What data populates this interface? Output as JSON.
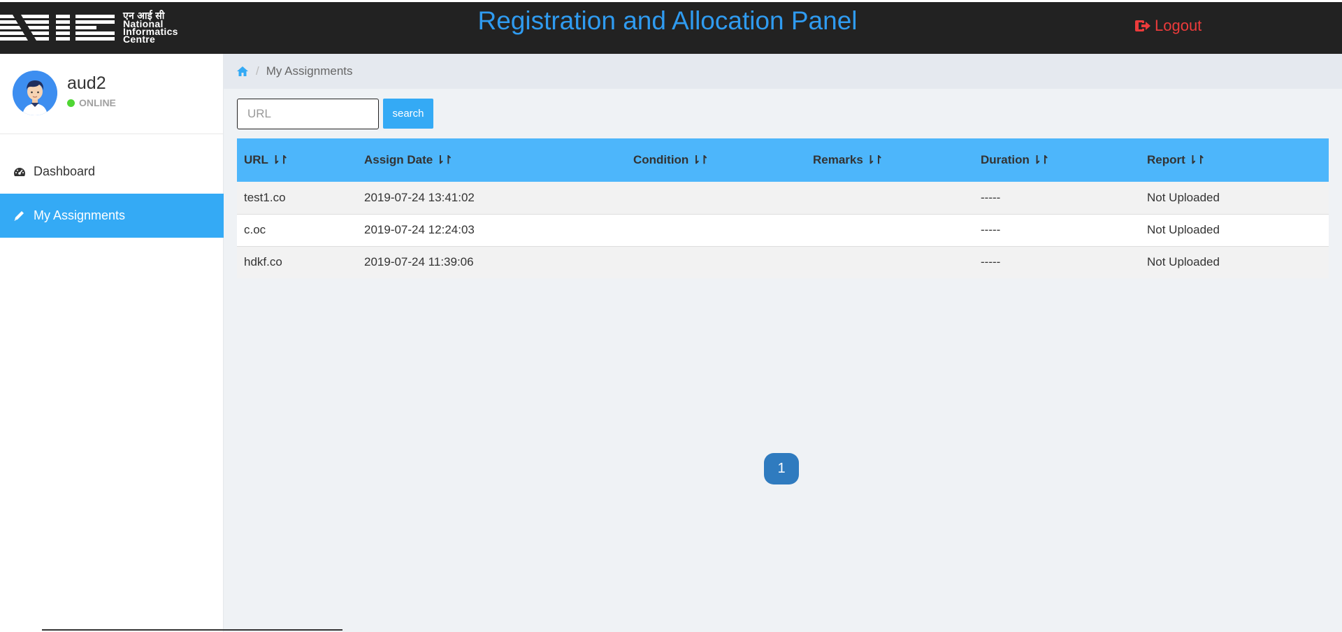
{
  "header": {
    "logo_hindi": "एन आई सी",
    "logo_lines": [
      "National",
      "Informatics",
      "Centre"
    ],
    "title": "Registration and Allocation Panel",
    "logout_label": "Logout"
  },
  "sidebar": {
    "user_name": "aud2",
    "user_status": "ONLINE",
    "items": [
      {
        "label": "Dashboard",
        "icon": "dashboard-icon"
      },
      {
        "label": "My Assignments",
        "icon": "pencil-icon",
        "active": true
      }
    ]
  },
  "breadcrumb": {
    "home_icon": "home-icon",
    "current": "My Assignments"
  },
  "search": {
    "placeholder": "URL",
    "value": "",
    "button_label": "search"
  },
  "table": {
    "columns": [
      "URL",
      "Assign Date",
      "Condition",
      "Remarks",
      "Duration",
      "Report"
    ],
    "rows": [
      {
        "url": "test1.co",
        "assign_date": "2019-07-24 13:41:02",
        "condition": "",
        "remarks": "",
        "duration": "-----",
        "report": "Not Uploaded"
      },
      {
        "url": "c.oc",
        "assign_date": "2019-07-24 12:24:03",
        "condition": "",
        "remarks": "",
        "duration": "-----",
        "report": "Not Uploaded"
      },
      {
        "url": "hdkf.co",
        "assign_date": "2019-07-24 11:39:06",
        "condition": "",
        "remarks": "",
        "duration": "-----",
        "report": "Not Uploaded"
      }
    ]
  },
  "pagination": {
    "current_page": "1"
  },
  "colors": {
    "accent": "#34aaf5",
    "header_bg": "#222222",
    "title": "#2f9bf0",
    "logout": "#ec3b3b",
    "online": "#4fd633"
  }
}
